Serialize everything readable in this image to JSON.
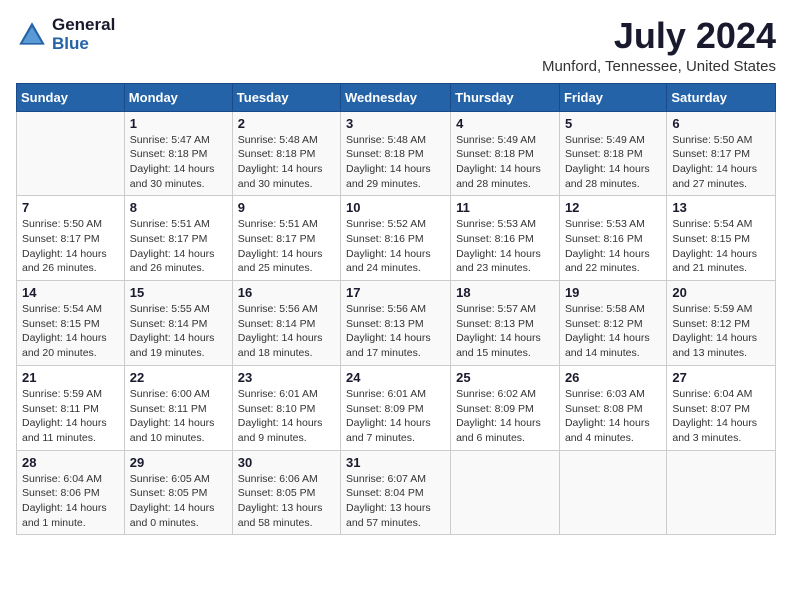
{
  "logo": {
    "general": "General",
    "blue": "Blue"
  },
  "header": {
    "month_year": "July 2024",
    "location": "Munford, Tennessee, United States"
  },
  "weekdays": [
    "Sunday",
    "Monday",
    "Tuesday",
    "Wednesday",
    "Thursday",
    "Friday",
    "Saturday"
  ],
  "weeks": [
    [
      {
        "day": "",
        "info": ""
      },
      {
        "day": "1",
        "info": "Sunrise: 5:47 AM\nSunset: 8:18 PM\nDaylight: 14 hours\nand 30 minutes."
      },
      {
        "day": "2",
        "info": "Sunrise: 5:48 AM\nSunset: 8:18 PM\nDaylight: 14 hours\nand 30 minutes."
      },
      {
        "day": "3",
        "info": "Sunrise: 5:48 AM\nSunset: 8:18 PM\nDaylight: 14 hours\nand 29 minutes."
      },
      {
        "day": "4",
        "info": "Sunrise: 5:49 AM\nSunset: 8:18 PM\nDaylight: 14 hours\nand 28 minutes."
      },
      {
        "day": "5",
        "info": "Sunrise: 5:49 AM\nSunset: 8:18 PM\nDaylight: 14 hours\nand 28 minutes."
      },
      {
        "day": "6",
        "info": "Sunrise: 5:50 AM\nSunset: 8:17 PM\nDaylight: 14 hours\nand 27 minutes."
      }
    ],
    [
      {
        "day": "7",
        "info": "Sunrise: 5:50 AM\nSunset: 8:17 PM\nDaylight: 14 hours\nand 26 minutes."
      },
      {
        "day": "8",
        "info": "Sunrise: 5:51 AM\nSunset: 8:17 PM\nDaylight: 14 hours\nand 26 minutes."
      },
      {
        "day": "9",
        "info": "Sunrise: 5:51 AM\nSunset: 8:17 PM\nDaylight: 14 hours\nand 25 minutes."
      },
      {
        "day": "10",
        "info": "Sunrise: 5:52 AM\nSunset: 8:16 PM\nDaylight: 14 hours\nand 24 minutes."
      },
      {
        "day": "11",
        "info": "Sunrise: 5:53 AM\nSunset: 8:16 PM\nDaylight: 14 hours\nand 23 minutes."
      },
      {
        "day": "12",
        "info": "Sunrise: 5:53 AM\nSunset: 8:16 PM\nDaylight: 14 hours\nand 22 minutes."
      },
      {
        "day": "13",
        "info": "Sunrise: 5:54 AM\nSunset: 8:15 PM\nDaylight: 14 hours\nand 21 minutes."
      }
    ],
    [
      {
        "day": "14",
        "info": "Sunrise: 5:54 AM\nSunset: 8:15 PM\nDaylight: 14 hours\nand 20 minutes."
      },
      {
        "day": "15",
        "info": "Sunrise: 5:55 AM\nSunset: 8:14 PM\nDaylight: 14 hours\nand 19 minutes."
      },
      {
        "day": "16",
        "info": "Sunrise: 5:56 AM\nSunset: 8:14 PM\nDaylight: 14 hours\nand 18 minutes."
      },
      {
        "day": "17",
        "info": "Sunrise: 5:56 AM\nSunset: 8:13 PM\nDaylight: 14 hours\nand 17 minutes."
      },
      {
        "day": "18",
        "info": "Sunrise: 5:57 AM\nSunset: 8:13 PM\nDaylight: 14 hours\nand 15 minutes."
      },
      {
        "day": "19",
        "info": "Sunrise: 5:58 AM\nSunset: 8:12 PM\nDaylight: 14 hours\nand 14 minutes."
      },
      {
        "day": "20",
        "info": "Sunrise: 5:59 AM\nSunset: 8:12 PM\nDaylight: 14 hours\nand 13 minutes."
      }
    ],
    [
      {
        "day": "21",
        "info": "Sunrise: 5:59 AM\nSunset: 8:11 PM\nDaylight: 14 hours\nand 11 minutes."
      },
      {
        "day": "22",
        "info": "Sunrise: 6:00 AM\nSunset: 8:11 PM\nDaylight: 14 hours\nand 10 minutes."
      },
      {
        "day": "23",
        "info": "Sunrise: 6:01 AM\nSunset: 8:10 PM\nDaylight: 14 hours\nand 9 minutes."
      },
      {
        "day": "24",
        "info": "Sunrise: 6:01 AM\nSunset: 8:09 PM\nDaylight: 14 hours\nand 7 minutes."
      },
      {
        "day": "25",
        "info": "Sunrise: 6:02 AM\nSunset: 8:09 PM\nDaylight: 14 hours\nand 6 minutes."
      },
      {
        "day": "26",
        "info": "Sunrise: 6:03 AM\nSunset: 8:08 PM\nDaylight: 14 hours\nand 4 minutes."
      },
      {
        "day": "27",
        "info": "Sunrise: 6:04 AM\nSunset: 8:07 PM\nDaylight: 14 hours\nand 3 minutes."
      }
    ],
    [
      {
        "day": "28",
        "info": "Sunrise: 6:04 AM\nSunset: 8:06 PM\nDaylight: 14 hours\nand 1 minute."
      },
      {
        "day": "29",
        "info": "Sunrise: 6:05 AM\nSunset: 8:05 PM\nDaylight: 14 hours\nand 0 minutes."
      },
      {
        "day": "30",
        "info": "Sunrise: 6:06 AM\nSunset: 8:05 PM\nDaylight: 13 hours\nand 58 minutes."
      },
      {
        "day": "31",
        "info": "Sunrise: 6:07 AM\nSunset: 8:04 PM\nDaylight: 13 hours\nand 57 minutes."
      },
      {
        "day": "",
        "info": ""
      },
      {
        "day": "",
        "info": ""
      },
      {
        "day": "",
        "info": ""
      }
    ]
  ]
}
